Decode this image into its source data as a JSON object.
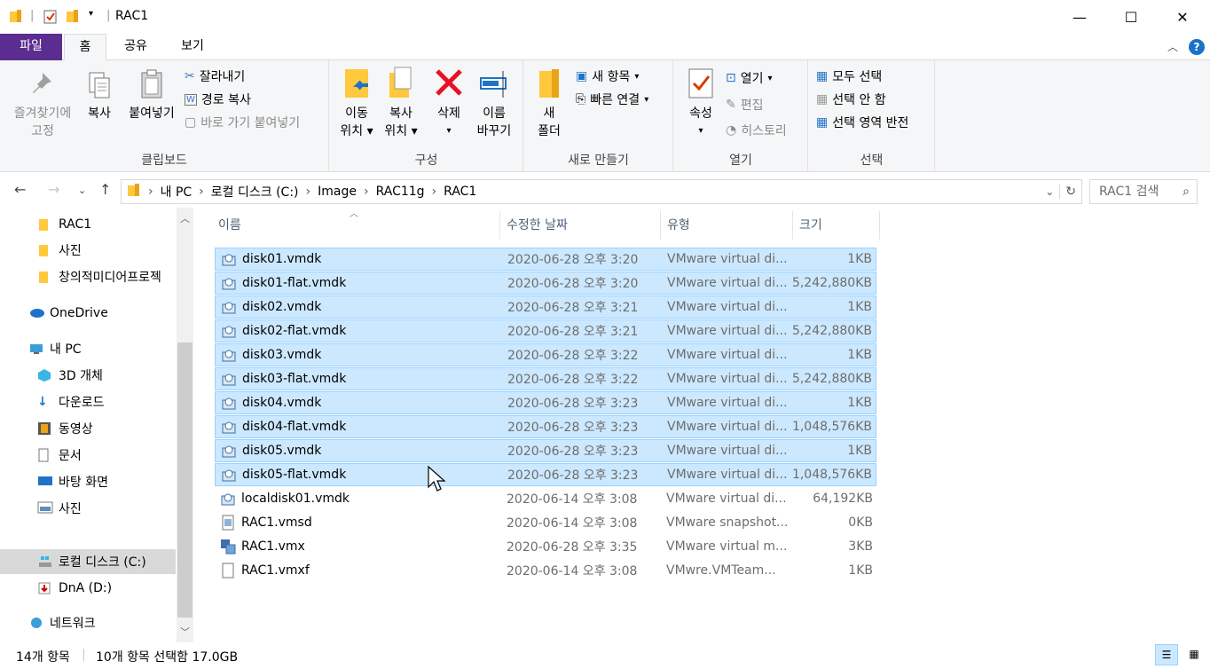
{
  "window": {
    "title": "RAC1"
  },
  "tabs": [
    {
      "label": "파일"
    },
    {
      "label": "홈"
    },
    {
      "label": "공유"
    },
    {
      "label": "보기"
    }
  ],
  "ribbon": {
    "clipboard": {
      "label": "클립보드",
      "pin": "즐겨찾기에\n고정",
      "pin1": "즐겨찾기에",
      "pin2": "고정",
      "copy": "복사",
      "paste": "붙여넣기",
      "cut": "잘라내기",
      "copy_path": "경로 복사",
      "paste_shortcut": "바로 가기 붙여넣기"
    },
    "organize": {
      "label": "구성",
      "move1": "이동",
      "move2": "위치",
      "copyto1": "복사",
      "copyto2": "위치",
      "delete": "삭제",
      "rename1": "이름",
      "rename2": "바꾸기"
    },
    "new": {
      "label": "새로 만들기",
      "folder1": "새",
      "folder2": "폴더",
      "new_item": "새 항목",
      "easy_access": "빠른 연결"
    },
    "open": {
      "label": "열기",
      "properties": "속성",
      "open": "열기",
      "edit": "편집",
      "history": "히스토리"
    },
    "select": {
      "label": "선택",
      "all": "모두 선택",
      "none": "선택 안 함",
      "invert": "선택 영역 반전"
    }
  },
  "address": {
    "crumbs": [
      "내 PC",
      "로컬 디스크 (C:)",
      "Image",
      "RAC11g",
      "RAC1"
    ],
    "search_placeholder": "RAC1 검색"
  },
  "nav": [
    {
      "label": "RAC1",
      "icon": "folder-icon"
    },
    {
      "label": "사진",
      "icon": "folder-icon"
    },
    {
      "label": "창의적미디어프로젝",
      "icon": "folder-icon"
    },
    {
      "label": "OneDrive",
      "icon": "cloud-icon"
    },
    {
      "label": "내 PC",
      "icon": "pc-icon"
    },
    {
      "label": "3D 개체",
      "icon": "cube-icon"
    },
    {
      "label": "다운로드",
      "icon": "download-icon"
    },
    {
      "label": "동영상",
      "icon": "film-icon"
    },
    {
      "label": "문서",
      "icon": "document-icon"
    },
    {
      "label": "바탕 화면",
      "icon": "desktop-icon"
    },
    {
      "label": "사진",
      "icon": "picture-icon"
    },
    {
      "label": "로컬 디스크 (C:)",
      "icon": "drive-icon"
    },
    {
      "label": "DnA (D:)",
      "icon": "drive-icon"
    },
    {
      "label": "네트워크",
      "icon": "network-icon"
    }
  ],
  "columns": {
    "name": "이름",
    "date": "수정한 날짜",
    "type": "유형",
    "size": "크기"
  },
  "files": [
    {
      "name": "disk01.vmdk",
      "date": "2020-06-28 오후 3:20",
      "type": "VMware virtual di...",
      "size": "1KB",
      "selected": true
    },
    {
      "name": "disk01-flat.vmdk",
      "date": "2020-06-28 오후 3:20",
      "type": "VMware virtual di...",
      "size": "5,242,880KB",
      "selected": true
    },
    {
      "name": "disk02.vmdk",
      "date": "2020-06-28 오후 3:21",
      "type": "VMware virtual di...",
      "size": "1KB",
      "selected": true
    },
    {
      "name": "disk02-flat.vmdk",
      "date": "2020-06-28 오후 3:21",
      "type": "VMware virtual di...",
      "size": "5,242,880KB",
      "selected": true
    },
    {
      "name": "disk03.vmdk",
      "date": "2020-06-28 오후 3:22",
      "type": "VMware virtual di...",
      "size": "1KB",
      "selected": true
    },
    {
      "name": "disk03-flat.vmdk",
      "date": "2020-06-28 오후 3:22",
      "type": "VMware virtual di...",
      "size": "5,242,880KB",
      "selected": true
    },
    {
      "name": "disk04.vmdk",
      "date": "2020-06-28 오후 3:23",
      "type": "VMware virtual di...",
      "size": "1KB",
      "selected": true
    },
    {
      "name": "disk04-flat.vmdk",
      "date": "2020-06-28 오후 3:23",
      "type": "VMware virtual di...",
      "size": "1,048,576KB",
      "selected": true
    },
    {
      "name": "disk05.vmdk",
      "date": "2020-06-28 오후 3:23",
      "type": "VMware virtual di...",
      "size": "1KB",
      "selected": true
    },
    {
      "name": "disk05-flat.vmdk",
      "date": "2020-06-28 오후 3:23",
      "type": "VMware virtual di...",
      "size": "1,048,576KB",
      "selected": true
    },
    {
      "name": "localdisk01.vmdk",
      "date": "2020-06-14 오후 3:08",
      "type": "VMware virtual di...",
      "size": "64,192KB",
      "selected": false
    },
    {
      "name": "RAC1.vmsd",
      "date": "2020-06-14 오후 3:08",
      "type": "VMware snapshot...",
      "size": "0KB",
      "selected": false
    },
    {
      "name": "RAC1.vmx",
      "date": "2020-06-28 오후 3:35",
      "type": "VMware virtual m...",
      "size": "3KB",
      "selected": false
    },
    {
      "name": "RAC1.vmxf",
      "date": "2020-06-14 오후 3:08",
      "type": "VMwre.VMTeam...",
      "size": "1KB",
      "selected": false
    }
  ],
  "status": {
    "count": "14개 항목",
    "selection": "10개 항목 선택함 17.0GB"
  },
  "colors": {
    "file_tab": "#5c2d91",
    "selection": "#cce8ff",
    "selection_border": "#99d1ff",
    "folder": "#ffc83d"
  }
}
